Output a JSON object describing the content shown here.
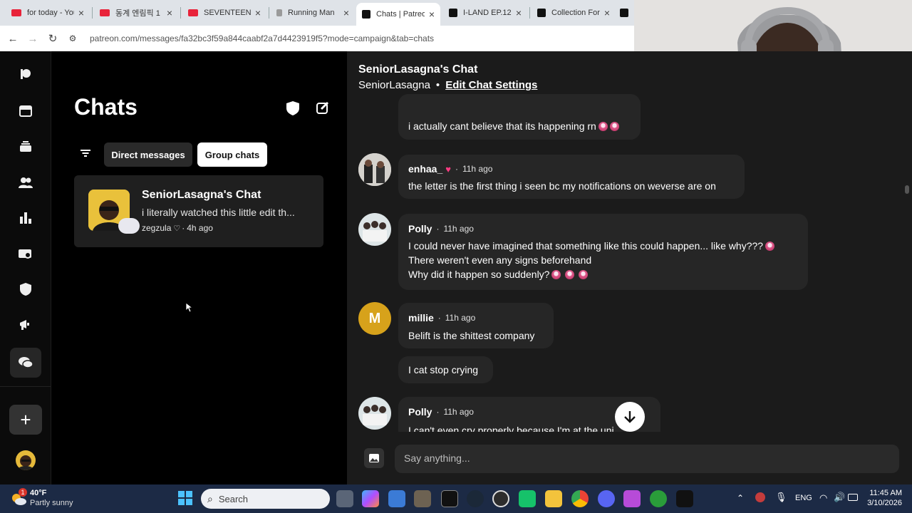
{
  "browser": {
    "tabs": [
      {
        "title": "for today - You",
        "favicon_color": "#e8233a"
      },
      {
        "title": "동계 엔림픽 1",
        "favicon_color": "#e8233a"
      },
      {
        "title": "SEVENTEEN -",
        "favicon_color": "#e8233a"
      },
      {
        "title": "Running Man",
        "favicon_color": "#9a9a9a"
      },
      {
        "title": "Chats | Patreon",
        "favicon_color": "#111111"
      },
      {
        "title": "I-LAND EP.12",
        "favicon_color": "#111111"
      },
      {
        "title": "Collection For",
        "favicon_color": "#111111"
      },
      {
        "title": "",
        "favicon_color": "#111111"
      }
    ],
    "url": "patreon.com/messages/fa32bc3f59a844caabf2a7d4423919f5?mode=campaign&tab=chats"
  },
  "rail": {
    "icons": [
      "patreon-logo-icon",
      "home-icon",
      "library-icon",
      "members-icon",
      "insights-icon",
      "payouts-icon",
      "shield-icon",
      "promotions-icon",
      "chats-icon"
    ],
    "add_label": "+"
  },
  "chats_panel": {
    "title": "Chats",
    "filter_direct": "Direct messages",
    "filter_group": "Group chats",
    "card": {
      "title": "SeniorLasagna's Chat",
      "preview": "i literally watched this little edit th...",
      "author": "zegzula",
      "time": "4h ago"
    }
  },
  "chat": {
    "title": "SeniorLasagna's Chat",
    "subtitle": "SeniorLasagna",
    "dot": "•",
    "edit_link": "Edit Chat Settings",
    "messages": [
      {
        "text": "i actually cant believe that its happening rn"
      },
      {
        "name": "enhaa_",
        "time": "11h ago",
        "text": "the letter is the first thing i seen bc my notifications on weverse are on"
      },
      {
        "name": "Polly",
        "time": "11h ago",
        "lines": [
          "I could never have imagined that something like this could happen... like why???",
          "There weren't even any signs beforehand",
          "Why did it happen so suddenly?"
        ]
      },
      {
        "name": "millie",
        "time": "11h ago",
        "initial": "M",
        "text": "Belift is the shittest company"
      },
      {
        "text": "I cat stop crying"
      },
      {
        "name": "Polly",
        "time": "11h ago",
        "text": "I can't even cry properly because I'm at the uni"
      }
    ],
    "sep": "·",
    "composer_placeholder": "Say anything..."
  },
  "taskbar": {
    "weather_temp": "40°F",
    "weather_desc": "Partly sunny",
    "weather_badge": "1",
    "search_placeholder": "Search",
    "lang": "ENG",
    "time": "11:45 AM",
    "date": "3/10/2026"
  }
}
